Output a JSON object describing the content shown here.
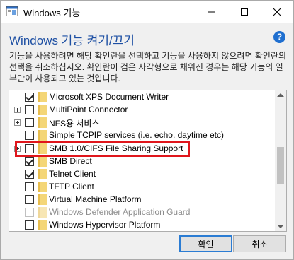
{
  "window": {
    "title": "Windows 기능",
    "icons": {
      "app": "windows-features-icon",
      "minimize": "minimize-icon",
      "maximize": "maximize-icon",
      "close": "close-icon"
    }
  },
  "header": {
    "heading": "Windows 기능 켜기/끄기",
    "help_label": "?",
    "description": "기능을 사용하려면 해당 확인란을 선택하고 기능을 사용하지 않으려면 확인란의 선택을 취소하십시오. 확인란이 검은 사각형으로 채워진 경우는 해당 기능의 일부만이 사용되고 있는 것입니다."
  },
  "features": [
    {
      "label": "Microsoft XPS Document Writer",
      "checked": true,
      "expandable": false,
      "disabled": false
    },
    {
      "label": "MultiPoint Connector",
      "checked": false,
      "expandable": true,
      "disabled": false
    },
    {
      "label": "NFS용 서비스",
      "checked": false,
      "expandable": true,
      "disabled": false
    },
    {
      "label": "Simple TCPIP services (i.e. echo, daytime etc)",
      "checked": false,
      "expandable": false,
      "disabled": false
    },
    {
      "label": "SMB 1.0/CIFS File Sharing Support",
      "checked": false,
      "expandable": true,
      "disabled": false
    },
    {
      "label": "SMB Direct",
      "checked": true,
      "expandable": false,
      "disabled": false
    },
    {
      "label": "Telnet Client",
      "checked": true,
      "expandable": false,
      "disabled": false
    },
    {
      "label": "TFTP Client",
      "checked": false,
      "expandable": false,
      "disabled": false
    },
    {
      "label": "Virtual Machine Platform",
      "checked": false,
      "expandable": false,
      "disabled": false
    },
    {
      "label": "Windows Defender Application Guard",
      "checked": false,
      "expandable": false,
      "disabled": true
    },
    {
      "label": "Windows Hypervisor Platform",
      "checked": false,
      "expandable": false,
      "disabled": false
    }
  ],
  "buttons": {
    "ok": "확인",
    "cancel": "취소"
  },
  "colors": {
    "heading": "#1d4fa3",
    "highlight": "#e0161c",
    "help": "#1f6fd0"
  }
}
